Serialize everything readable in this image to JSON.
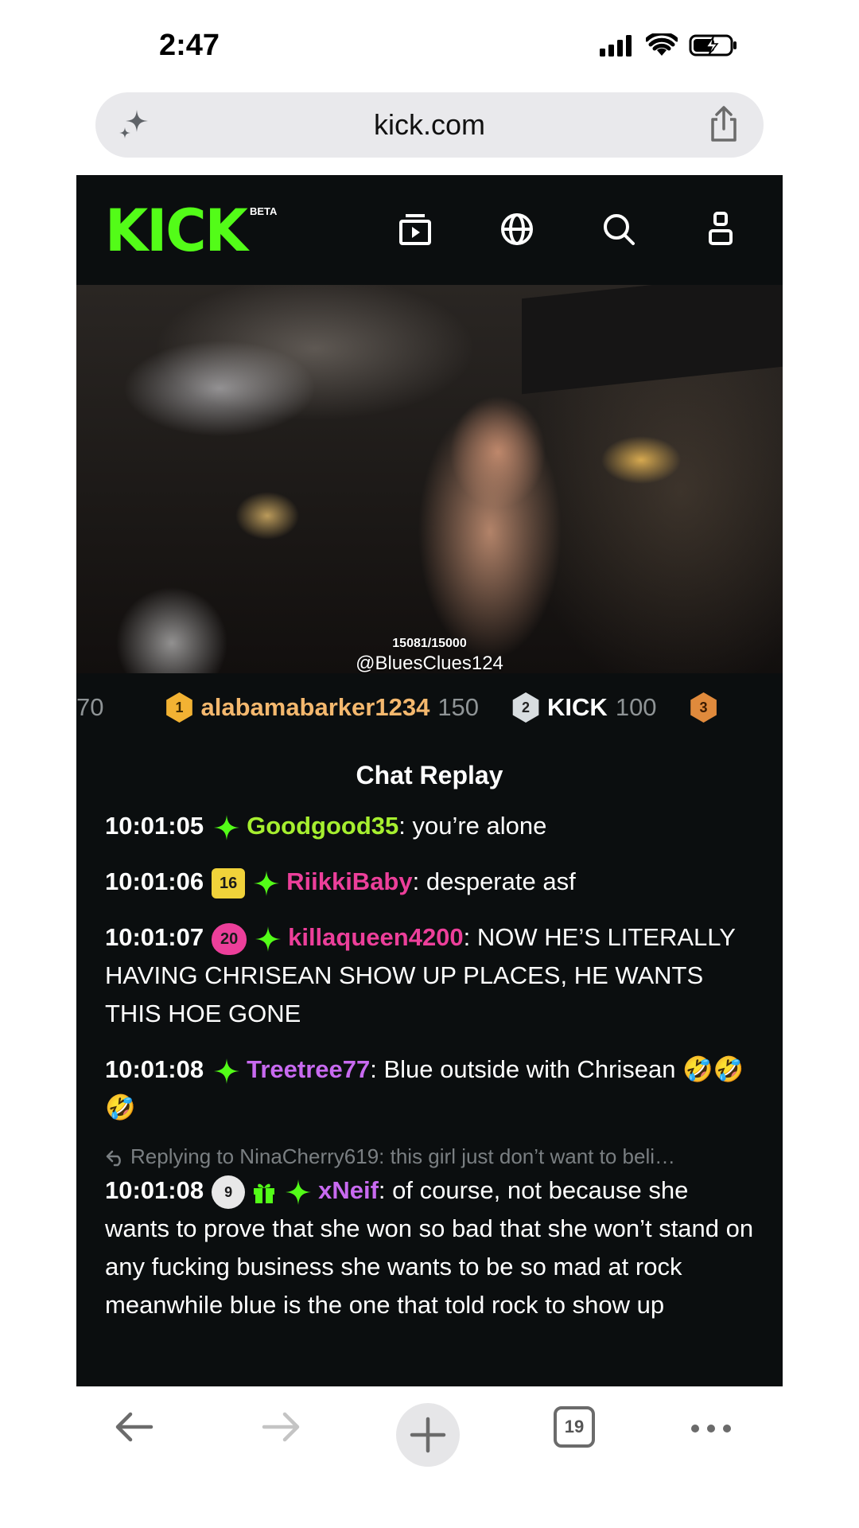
{
  "status_bar": {
    "time": "2:47"
  },
  "browser": {
    "url": "kick.com",
    "tab_count": "19"
  },
  "kick": {
    "logo": "KICK",
    "beta": "BETA",
    "brand_color": "#53fc18"
  },
  "video": {
    "counter": "15081/15000",
    "handle": "@BluesClues124"
  },
  "leaderboard": {
    "partial_points": "70",
    "entries": [
      {
        "rank": "1",
        "name": "alabamabarker1234",
        "points": "150",
        "name_color": "#f4b86e",
        "badge_color": "#f2b233"
      },
      {
        "rank": "2",
        "name": "KICK",
        "points": "100",
        "name_color": "#ffffff",
        "badge_color": "#d8dde0"
      },
      {
        "rank": "3",
        "name": "",
        "points": "",
        "name_color": "#ffffff",
        "badge_color": "#e08a3c"
      }
    ]
  },
  "chat": {
    "title": "Chat Replay",
    "messages": [
      {
        "time": "10:01:05",
        "user": "Goodgood35",
        "text": "you’re alone",
        "color": "#a6ef2f"
      },
      {
        "time": "10:01:06",
        "badge": "16",
        "user": "RiikkiBaby",
        "text": "desperate asf",
        "color": "#ec3f9a"
      },
      {
        "time": "10:01:07",
        "badge": "20",
        "user": "killaqueen4200",
        "text": "NOW HE’S LITERALLY HAVING CHRISEAN SHOW UP PLACES, HE WANTS THIS HOE GONE",
        "color": "#ec3f9a"
      },
      {
        "time": "10:01:08",
        "user": "Treetree77",
        "text": "Blue outside with Chrisean 🤣🤣🤣",
        "color": "#c86af0"
      },
      {
        "time": "10:01:08",
        "badge": "9",
        "user": "xNeif",
        "text": "of course, not because she wants to prove that she won so bad that she won’t stand on any fucking business she wants to be so mad at rock meanwhile blue is the one that told rock to show up",
        "color": "#c86af0"
      }
    ],
    "reply_preview": "Replying to NinaCherry619: this girl just don’t want to beli…"
  }
}
